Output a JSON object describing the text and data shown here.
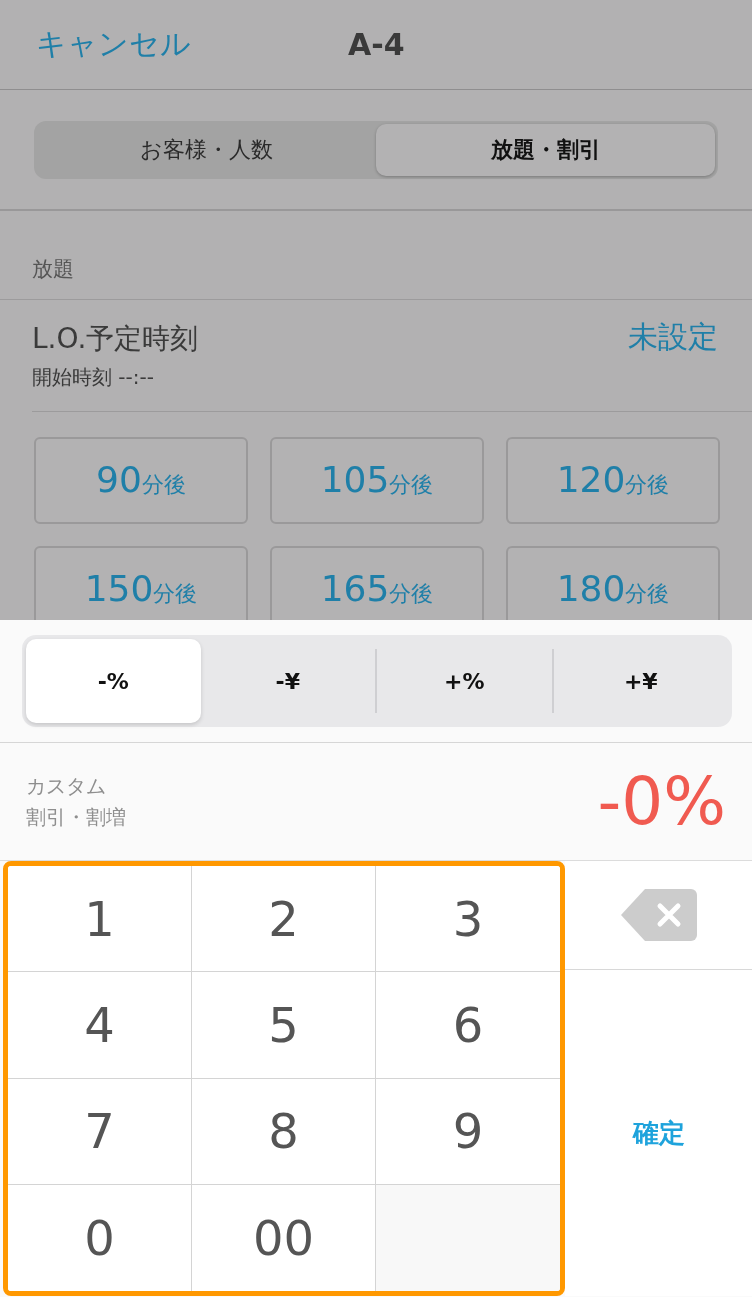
{
  "nav": {
    "cancel": "キャンセル",
    "title": "A-4"
  },
  "tabs": [
    {
      "label": "お客様・人数",
      "selected": false
    },
    {
      "label": "放題・割引",
      "selected": true
    }
  ],
  "section_header": "放題",
  "lo_row": {
    "title": "L.O.予定時刻",
    "subtitle": "開始時刻 --:--",
    "value": "未設定"
  },
  "time_buttons": [
    {
      "number": "90",
      "unit": "分後"
    },
    {
      "number": "105",
      "unit": "分後"
    },
    {
      "number": "120",
      "unit": "分後"
    },
    {
      "number": "150",
      "unit": "分後"
    },
    {
      "number": "165",
      "unit": "分後"
    },
    {
      "number": "180",
      "unit": "分後"
    }
  ],
  "discount_types": [
    {
      "label": "-%",
      "selected": true
    },
    {
      "label": "-¥",
      "selected": false
    },
    {
      "label": "+%",
      "selected": false
    },
    {
      "label": "+¥",
      "selected": false
    }
  ],
  "custom": {
    "title": "カスタム",
    "subtitle": "割引・割増",
    "value": "-0%"
  },
  "keypad": {
    "keys": [
      "1",
      "2",
      "3",
      "4",
      "5",
      "6",
      "7",
      "8",
      "9",
      "0",
      "00"
    ],
    "confirm": "確定"
  }
}
